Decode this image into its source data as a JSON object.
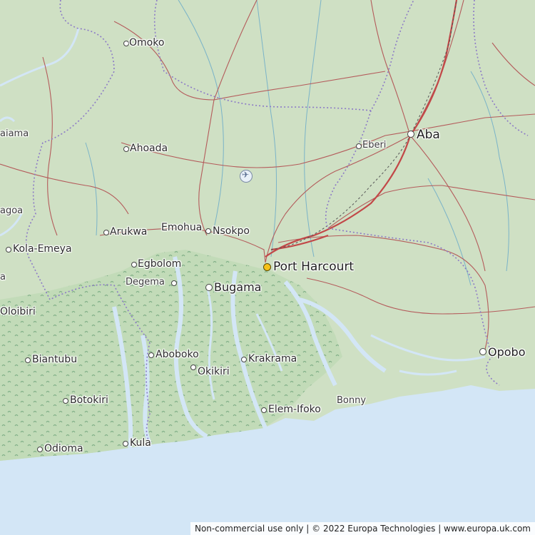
{
  "map": {
    "attribution": "Non-commercial use only | © 2022 Europa Technologies | www.europa.uk.com",
    "colors": {
      "sea": "#d3e6f6",
      "land": "#cfe0c4",
      "wetland": "#bcd7b4",
      "road": "#b45b5b",
      "boundary": "#8c7ac6",
      "river": "#7ab3c8"
    },
    "places": {
      "port_harcourt": "Port Harcourt",
      "aba": "Aba",
      "opobo": "Opobo",
      "bugama": "Bugama",
      "omoko": "Omoko",
      "ahoada": "Ahoada",
      "eberi": "Eberi",
      "arukwa": "Arukwa",
      "emohua": "Emohua",
      "nsokpo": "Nsokpo",
      "egbolom": "Egbolom",
      "degema": "Degema",
      "kola_emeya": "Kola-Emeya",
      "oloibiri": "Oloibiri",
      "biantubu": "Biantubu",
      "aboboko": "Aboboko",
      "okikiri": "Okikiri",
      "krakrama": "Krakrama",
      "botokiri": "Botokiri",
      "elem_ifoko": "Elem-Ifoko",
      "bonny": "Bonny",
      "odioma": "Odioma",
      "kula": "Kula",
      "aiama_partial": "aiama",
      "agoa_partial": "agoa",
      "edge_a": "a"
    },
    "icons": {
      "airport": "airport-icon"
    }
  }
}
